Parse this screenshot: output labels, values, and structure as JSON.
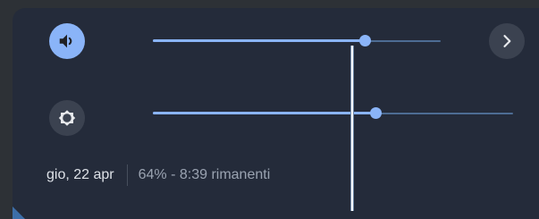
{
  "volume": {
    "icon": "volume-icon",
    "level": 0.74
  },
  "brightness": {
    "icon": "brightness-icon",
    "level": 0.62
  },
  "next_button": {
    "icon": "chevron-right-icon"
  },
  "status": {
    "date": "gio, 22 apr",
    "battery": "64% - 8:39 rimanenti"
  },
  "colors": {
    "accent": "#8ab4f8",
    "panel_background": "#242b3a",
    "secondary_button": "#3b4250"
  }
}
